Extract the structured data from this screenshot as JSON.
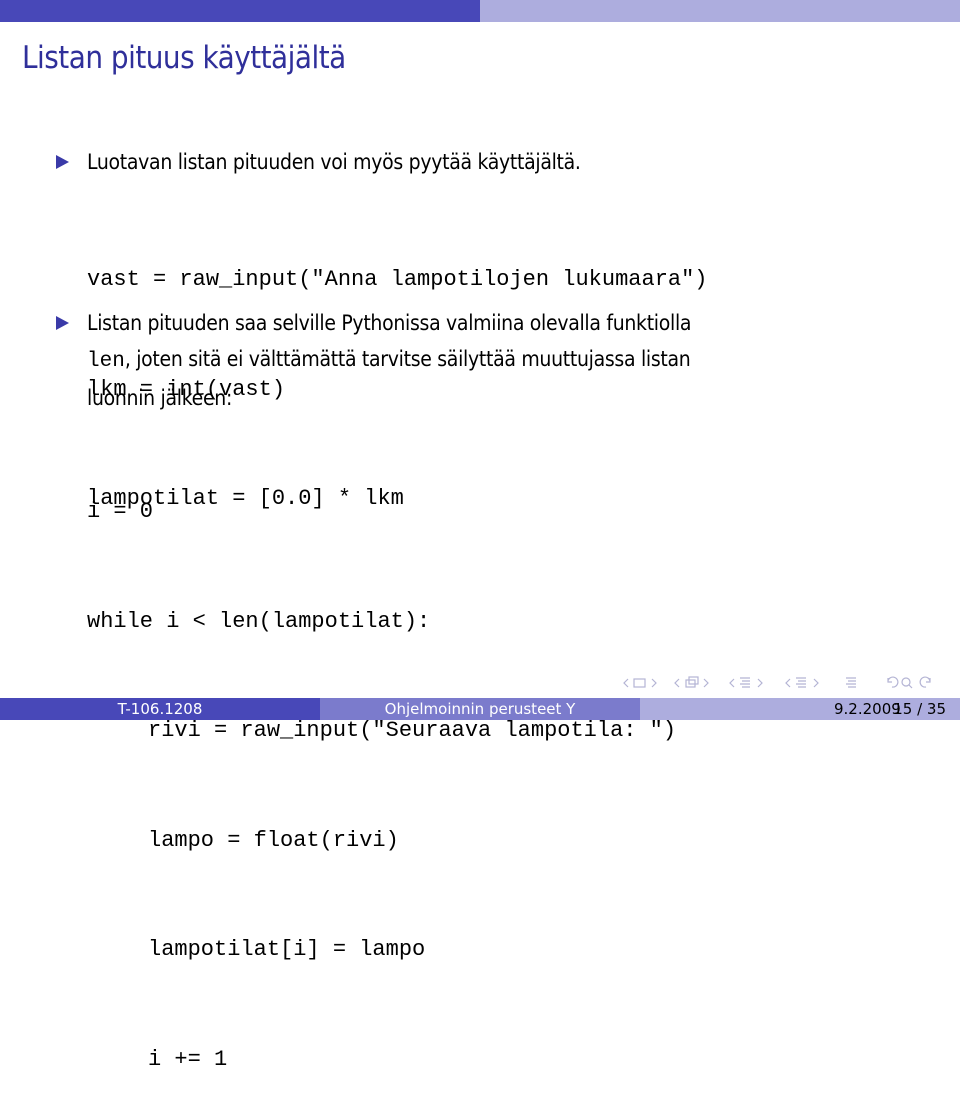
{
  "slide": {
    "title": "Listan pituus käyttäjältä",
    "bullets": [
      {
        "text": "Luotavan listan pituuden voi myös pyytää käyttäjältä.",
        "code": [
          "vast = raw_input(\"Anna lampotilojen lukumaara\")",
          "lkm = int(vast)",
          "lampotilat = [0.0] * lkm"
        ]
      },
      {
        "text_line1": "Listan pituuden saa selville Pythonissa valmiina olevalla funktiolla",
        "inline_code": "len",
        "text_line2_rest": ", joten sitä ei välttämättä tarvitse säilyttää muuttujassa listan",
        "text_line3": "luonnin jälkeen:",
        "code": [
          "i = 0",
          "while i < len(lampotilat):",
          "rivi = raw_input(\"Seuraava lampotila: \")",
          "lampo = float(rivi)",
          "lampotilat[i] = lampo",
          "i += 1"
        ]
      }
    ]
  },
  "navigation": {
    "icons": [
      "nav-left-arrow",
      "frame-icon",
      "nav-right-arrow",
      "nav-left-arrow",
      "subsection-icon",
      "nav-right-arrow",
      "nav-left-arrow",
      "section-icon",
      "nav-right-arrow",
      "nav-left-arrow",
      "subsection-icon",
      "nav-right-arrow",
      "toc-icon",
      "undo-icon",
      "search-icon",
      "redo-icon"
    ]
  },
  "footer": {
    "course_code": "T-106.1208",
    "course_name": "Ohjelmoinnin perusteet Y",
    "date": "9.2.2009",
    "page_current": "15",
    "page_total": "35",
    "page_separator": "/"
  },
  "colors": {
    "dark": "#4848b8",
    "medium": "#7b7bcc",
    "light": "#adadde",
    "title": "#2f2f9a"
  }
}
